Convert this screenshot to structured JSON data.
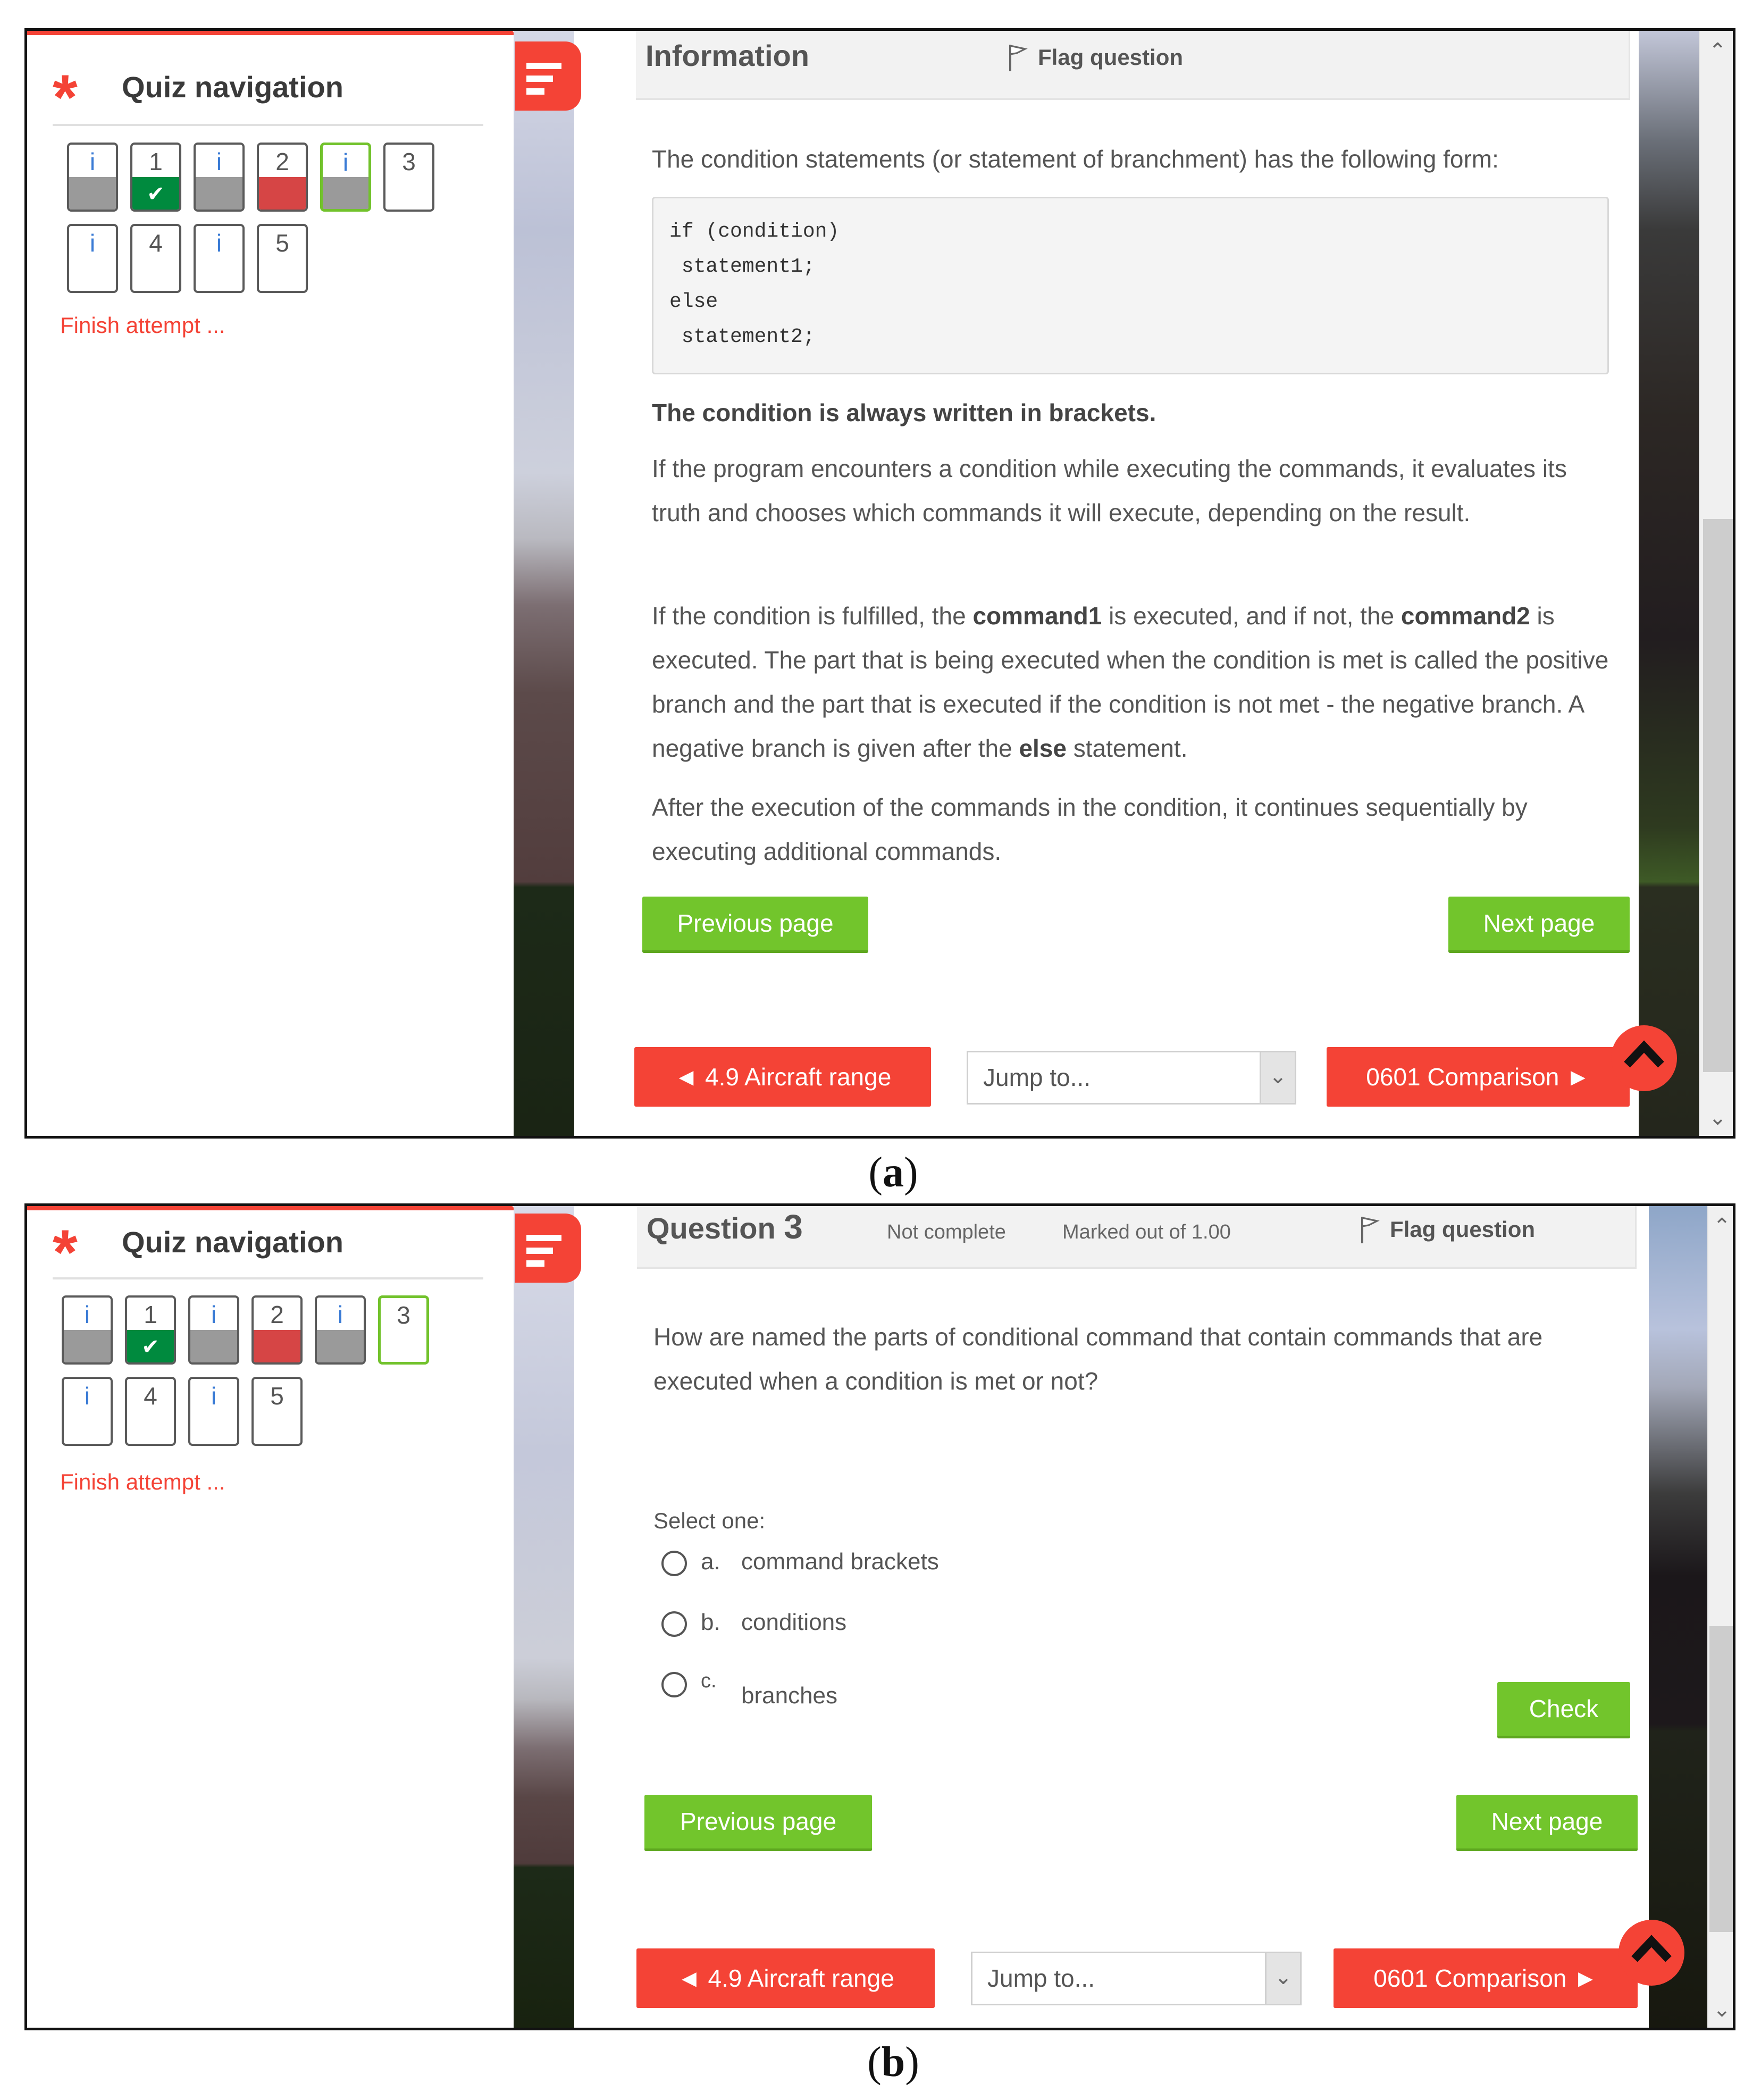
{
  "panels": [
    {
      "caption": "a",
      "sidebar": {
        "title": "Quiz navigation",
        "finish_label": "Finish attempt ...",
        "questions": [
          {
            "label": "i",
            "type": "info",
            "state": "gray"
          },
          {
            "label": "1",
            "type": "question",
            "state": "correct"
          },
          {
            "label": "i",
            "type": "info",
            "state": "gray"
          },
          {
            "label": "2",
            "type": "question",
            "state": "incorrect"
          },
          {
            "label": "i",
            "type": "info",
            "state": "gray",
            "current": true
          },
          {
            "label": "3",
            "type": "question",
            "state": "empty"
          },
          {
            "label": "i",
            "type": "info",
            "state": "empty"
          },
          {
            "label": "4",
            "type": "question",
            "state": "empty"
          },
          {
            "label": "i",
            "type": "info",
            "state": "empty"
          },
          {
            "label": "5",
            "type": "question",
            "state": "empty"
          }
        ]
      },
      "header": {
        "title": "Information",
        "flag_label": "Flag question"
      },
      "content": {
        "intro": "The condition statements (or statement of branchment) has the following form:",
        "code_lines": [
          "if (condition)",
          " statement1;",
          "else",
          " statement2;"
        ],
        "bold_note": "The condition is always written in brackets.",
        "para1": "If the program encounters a condition while executing the commands, it evaluates its truth and chooses which commands it will execute, depending on the result.",
        "para2_parts": {
          "p1": "If the condition is fulfilled, the ",
          "b1": "command1",
          "p2": " is executed, and if not, the ",
          "b2": "command2",
          "p3": " is executed. The part that is being executed when the condition is met is called the positive branch and the part that is executed if the condition is not met - the negative branch. A negative branch is given after the ",
          "b3": "else",
          "p4": " statement."
        },
        "para3": "After the execution of the commands in the condition, it continues sequentially by executing additional commands."
      },
      "buttons": {
        "previous_page": "Previous page",
        "next_page": "Next page",
        "prev_activity": "◄ 4.9 Aircraft range",
        "jump_placeholder": "Jump to...",
        "next_activity": "0601 Comparison ►"
      },
      "scroll_position": 0.68
    },
    {
      "caption": "b",
      "sidebar": {
        "title": "Quiz navigation",
        "finish_label": "Finish attempt ...",
        "questions": [
          {
            "label": "i",
            "type": "info",
            "state": "gray"
          },
          {
            "label": "1",
            "type": "question",
            "state": "correct"
          },
          {
            "label": "i",
            "type": "info",
            "state": "gray"
          },
          {
            "label": "2",
            "type": "question",
            "state": "incorrect"
          },
          {
            "label": "i",
            "type": "info",
            "state": "gray"
          },
          {
            "label": "3",
            "type": "question",
            "state": "empty",
            "current": true
          },
          {
            "label": "i",
            "type": "info",
            "state": "empty"
          },
          {
            "label": "4",
            "type": "question",
            "state": "empty"
          },
          {
            "label": "i",
            "type": "info",
            "state": "empty"
          },
          {
            "label": "5",
            "type": "question",
            "state": "empty"
          }
        ]
      },
      "header": {
        "title_prefix": "Question ",
        "question_number": "3",
        "status": "Not complete",
        "marks": "Marked out of 1.00",
        "flag_label": "Flag question"
      },
      "content": {
        "question_text": "How are named the parts of conditional command that contain commands that are executed when a condition is met or not?",
        "select_prompt": "Select one:",
        "options": [
          {
            "letter": "a.",
            "text": "command brackets",
            "selected": false
          },
          {
            "letter": "b.",
            "text": "conditions",
            "selected": false
          },
          {
            "letter": "c.",
            "text": "branches",
            "selected": false
          }
        ],
        "check_label": "Check"
      },
      "buttons": {
        "previous_page": "Previous page",
        "next_page": "Next page",
        "prev_activity": "◄ 4.9 Aircraft range",
        "jump_placeholder": "Jump to...",
        "next_activity": "0601 Comparison ►"
      },
      "scroll_position": 0.72
    }
  ],
  "colors": {
    "accent_red": "#f44336",
    "accent_green": "#72c52c",
    "correct_green": "#008a3e",
    "incorrect_red": "#d64545",
    "answered_gray": "#9a9a9a",
    "current_border": "#72c22c"
  }
}
